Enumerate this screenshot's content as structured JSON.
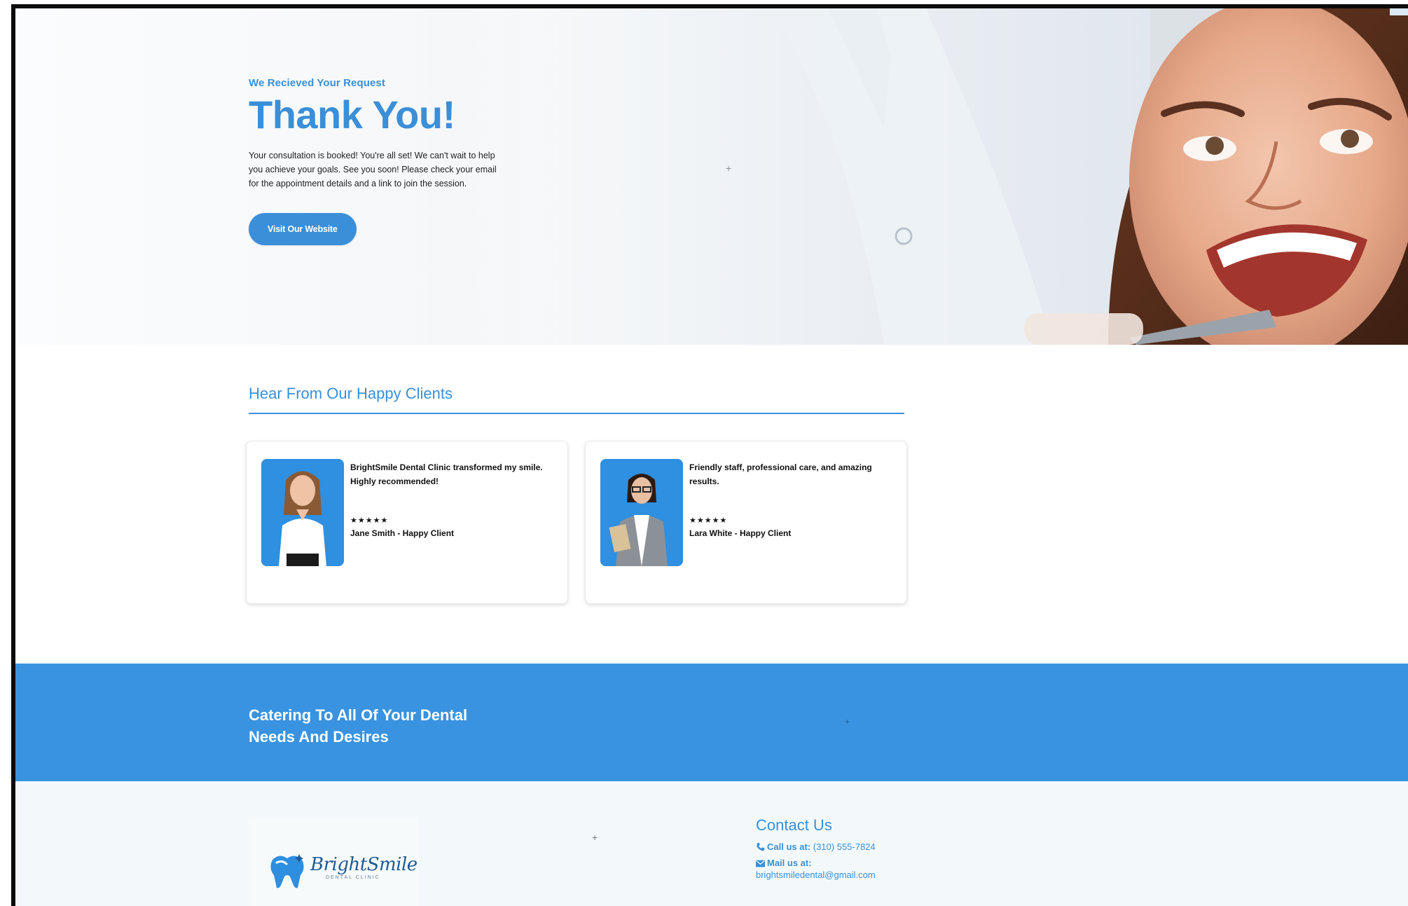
{
  "hero": {
    "eyebrow": "We Recieved Your Request",
    "title": "Thank You!",
    "body": "Your consultation is booked! You're all set! We can't wait to help you achieve your goals. See you soon! Please check your email for the appointment details and a link to join the session.",
    "button_label": "Visit Our Website"
  },
  "testimonials": {
    "title": "Hear From Our Happy Clients",
    "items": [
      {
        "quote": "BrightSmile Dental Clinic transformed my smile. Highly recommended!",
        "stars": "★★★★★",
        "name": "Jane Smith - Happy Client"
      },
      {
        "quote": "Friendly staff, professional care, and amazing results.",
        "stars": "★★★★★",
        "name": "Lara White - Happy Client"
      }
    ]
  },
  "band": {
    "text": "Catering To All Of Your Dental Needs And Desires"
  },
  "footer": {
    "logo": {
      "brand": "BrightSmile",
      "tagline": "DENTAL CLINIC"
    },
    "contact": {
      "title": "Contact Us",
      "call_label": "Call us at:",
      "call_value": "(310) 555-7824",
      "mail_label": "Mail us at:",
      "mail_value": "brightsmiledental@gmail.com"
    }
  },
  "colors": {
    "accent": "#3a8fd8",
    "band": "#3993e0",
    "footer_bg": "#f3f9fb"
  },
  "icons": [
    "phone-icon",
    "envelope-icon",
    "tooth-logo-icon",
    "sparkle-icon"
  ]
}
